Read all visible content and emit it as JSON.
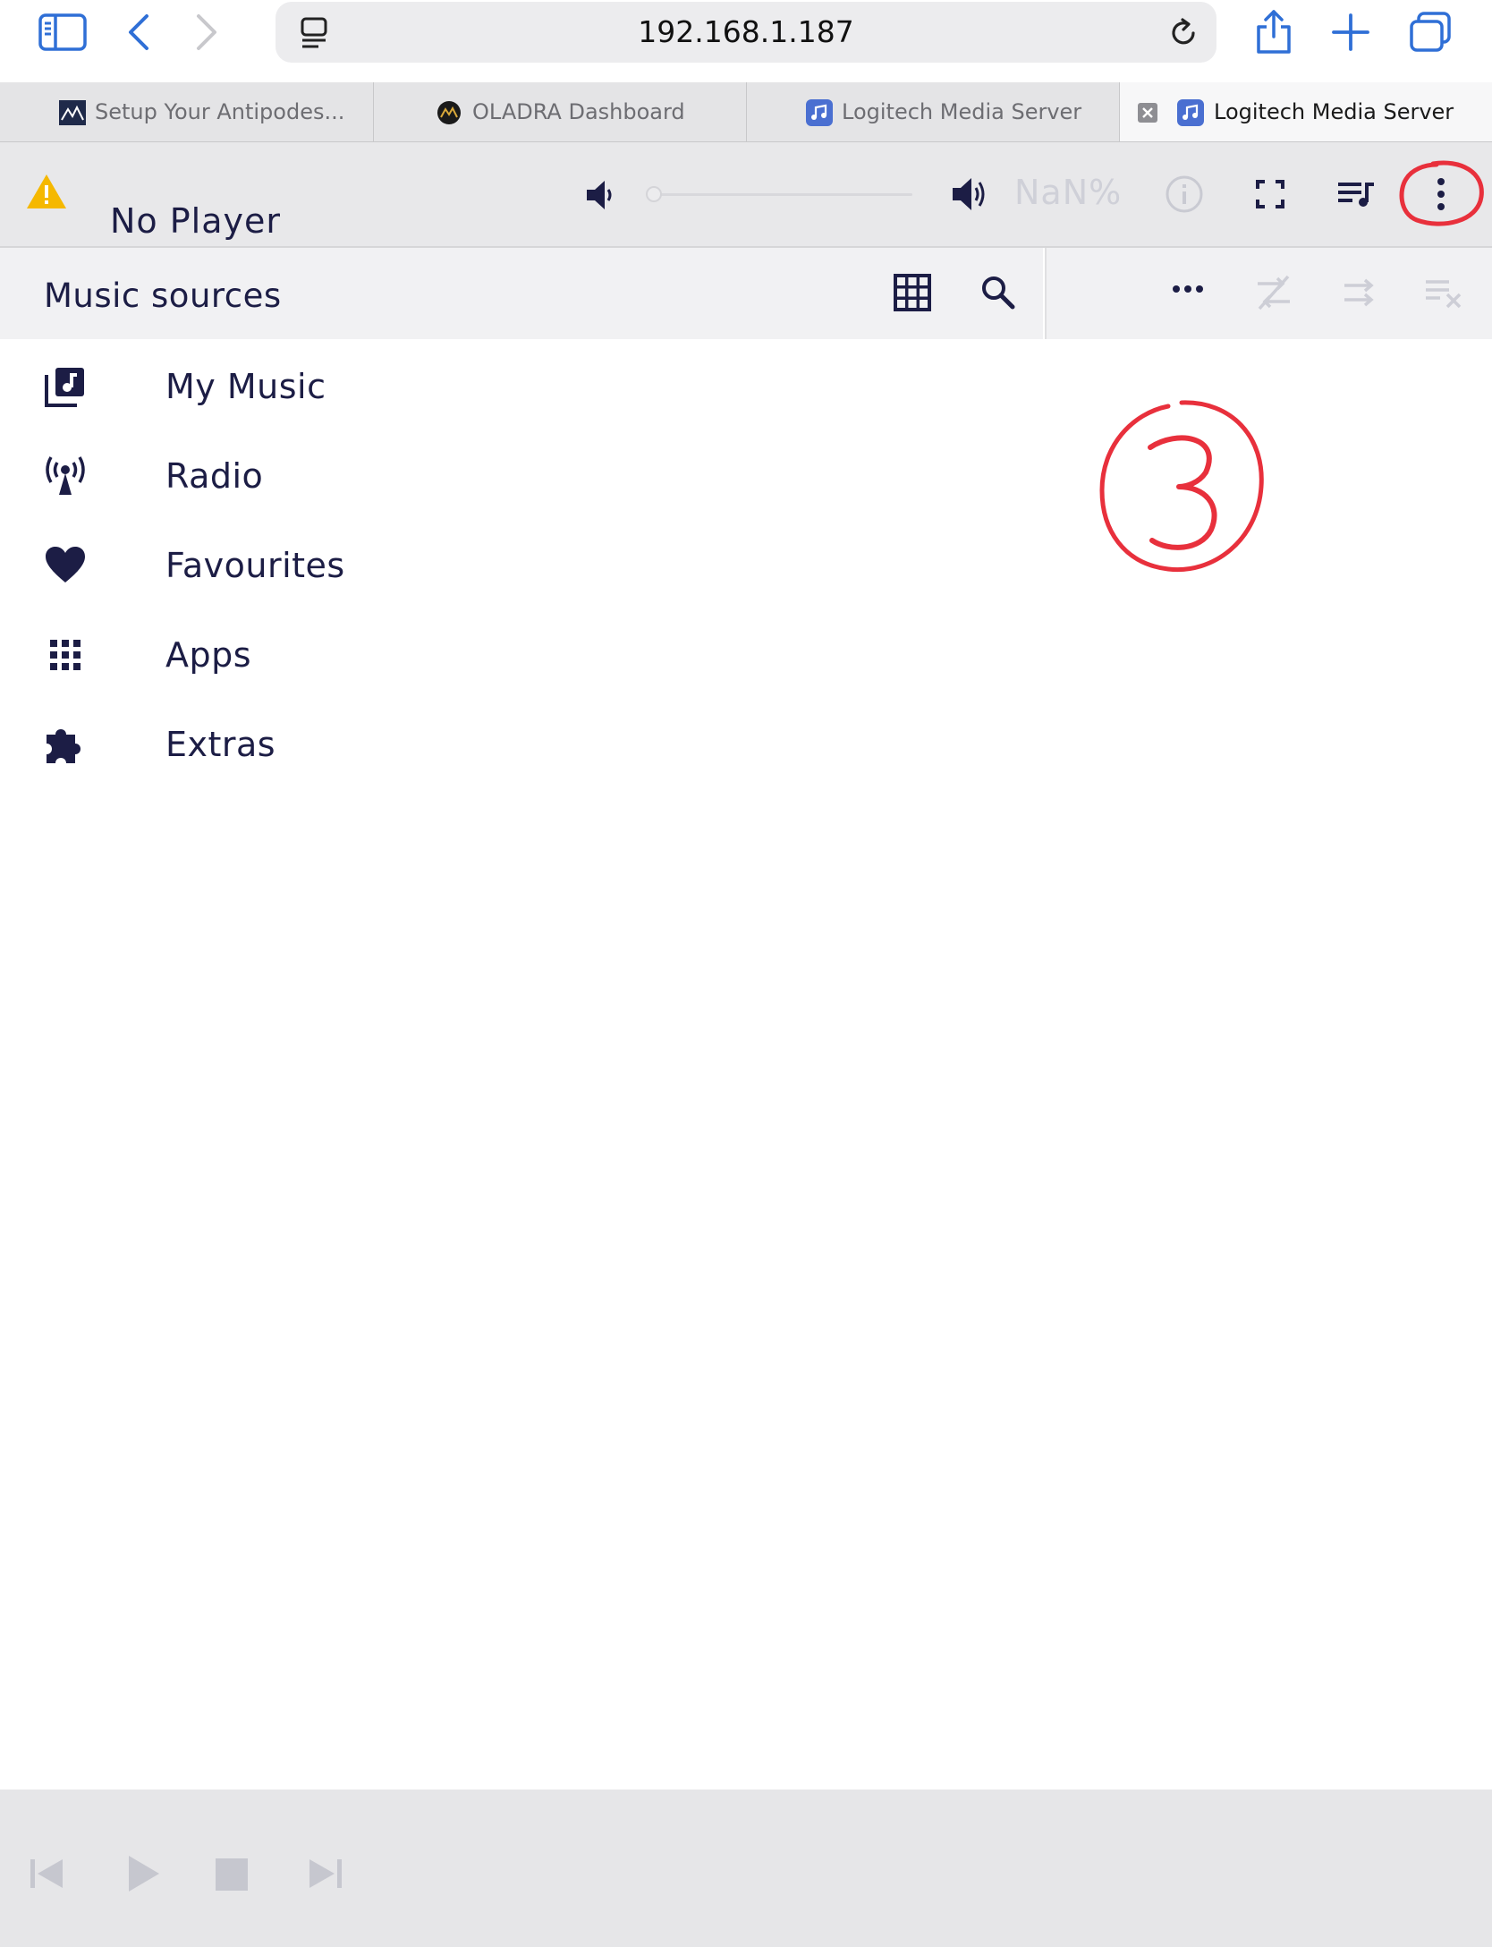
{
  "browser": {
    "url": "192.168.1.187",
    "tabs": [
      {
        "title": "Setup Your Antipodes...",
        "active": false
      },
      {
        "title": "OLADRA Dashboard",
        "active": false
      },
      {
        "title": "Logitech Media Server",
        "active": false
      },
      {
        "title": "Logitech Media Server",
        "active": true
      }
    ],
    "accent_color": "#2f6fd6"
  },
  "app": {
    "player_name": "No Player",
    "volume_text": "NaN%",
    "volume_level": 0,
    "warning_icon": "warning-icon",
    "warning_color": "#f5b800"
  },
  "browse": {
    "title": "Music sources",
    "items": [
      {
        "label": "My Music",
        "icon": "library-music-icon"
      },
      {
        "label": "Radio",
        "icon": "radio-tower-icon"
      },
      {
        "label": "Favourites",
        "icon": "heart-icon"
      },
      {
        "label": "Apps",
        "icon": "apps-grid-icon"
      },
      {
        "label": "Extras",
        "icon": "puzzle-icon"
      }
    ]
  },
  "annotation": {
    "number": "3",
    "color": "#e8303c"
  }
}
